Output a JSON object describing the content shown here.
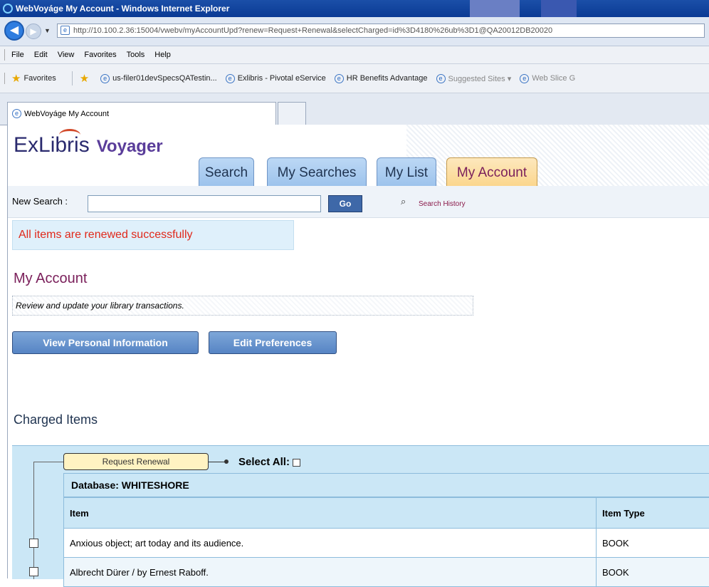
{
  "browser": {
    "title": "WebVoyáge My Account - Windows Internet Explorer",
    "url": "http://10.100.2.36:15004/vwebv/myAccountUpd?renew=Request+Renewal&selectCharged=id%3D4180%26ub%3D1@QA20012DB20020",
    "menu": [
      "File",
      "Edit",
      "View",
      "Favorites",
      "Tools",
      "Help"
    ],
    "favorites_label": "Favorites",
    "favorites": [
      "us-filer01devSpecsQATestin...",
      "Exlibris - Pivotal eService",
      "HR Benefits Advantage",
      "Suggested Sites ▾",
      "Web Slice G"
    ],
    "tab_title": "WebVoyáge My Account"
  },
  "header": {
    "logo_text": "ExLibris",
    "logo_product": "Voyager",
    "tabs": [
      "Search",
      "My Searches",
      "My List",
      "My Account"
    ],
    "active_tab": "My Account"
  },
  "search": {
    "label": "New Search :",
    "value": "",
    "go": "Go",
    "history": "Search History"
  },
  "status_message": "All items are renewed successfully",
  "account": {
    "title": "My Account",
    "subtitle": "Review and update your library transactions.",
    "view_personal": "View Personal Information",
    "edit_prefs": "Edit Preferences"
  },
  "charged": {
    "title": "Charged Items",
    "renew_button": "Request Renewal",
    "select_all": "Select All:",
    "database": "Database: WHITESHORE",
    "columns": [
      "Item",
      "Item Type"
    ],
    "rows": [
      {
        "item": "Anxious object; art today and its audience.",
        "type": "BOOK"
      },
      {
        "item": "Albrecht Dürer / by Ernest Raboff.",
        "type": "BOOK"
      }
    ]
  },
  "colors": {
    "accent": "#7a1f5a",
    "error": "#e0281a",
    "panel": "#cbe7f6"
  }
}
